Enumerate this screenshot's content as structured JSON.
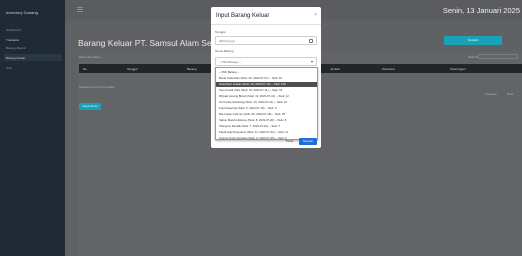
{
  "sidebar": {
    "brand": "Inventory Gudang",
    "items": [
      {
        "label": "Dashboard"
      },
      {
        "label": "Transaksi"
      },
      {
        "label": "Barang Masuk"
      },
      {
        "label": "Barang Keluar"
      },
      {
        "label": "Stok"
      }
    ]
  },
  "topbar": {
    "date": "Senin, 13 Januari 2025"
  },
  "page": {
    "title": "Barang Keluar PT. Samsul Alam Sehat",
    "add_button": "Tambah",
    "show_entries": "Show 10 entries",
    "search_label": "Search:",
    "columns": [
      "No",
      "Tanggal",
      "Barang",
      "Jumlah",
      "Penerima",
      "Keterangan"
    ],
    "showing": "Showing 0 to 0 of 0 entries",
    "pager": [
      "Previous",
      "Next"
    ],
    "small_button": "Export Excel"
  },
  "modal": {
    "title": "Input Barang Keluar",
    "close": "×",
    "date_label": "Tanggal",
    "date_placeholder": "dd/mm/yyyy",
    "item_label": "Nama Barang",
    "item_selected": "-- Pilih Barang --",
    "options": [
      "-- Pilih Barang --",
      "Beras Kuda Mas (Stok: 30, 2023-07-07) -- Stok: 10",
      "Gula Pasir Gulaku (Stok: 20, 2023-07-10) -- Stok: 100",
      "Susu Kotak Ultra (Stok: 15, 2023-07-11) -- Stok: 15",
      "Minyak Goreng Bimoli (Stok: 12, 2023-07-12) -- Stok: 12",
      "Teh Celup Sariwangi (Stok: 10, 2023-07-14) -- Stok: 10",
      "Kopi Kapal Api (Stok: 9, 2023-07-15) -- Stok: 9",
      "Mie Instan Indomie (Stok: 25, 2023-07-18) -- Stok: 25",
      "Sabun Mandi Lifebuoy (Stok: 8, 2023-07-20) -- Stok: 8",
      "Shampoo Sunsilk (Stok: 7, 2023-07-21) -- Stok: 7",
      "Pasta Gigi Pepsodent (Stok: 11, 2023-07-22) -- Stok: 11",
      "Tepung Terigu Segitiga (Stok: 6, 2023-07-25) -- Stok: 6"
    ],
    "selected_index": 2,
    "close_button": "Tutup",
    "save_button": "Simpan"
  }
}
